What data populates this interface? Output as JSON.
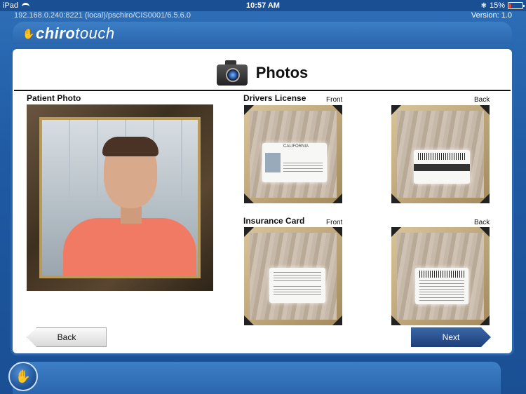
{
  "statusbar": {
    "device": "iPad",
    "time": "10:57 AM",
    "battery": "15%",
    "battery_level": 0.15
  },
  "urlbar": {
    "url": "192.168.0.240:8221 (local)/pschiro/CIS0001/6.5.6.0",
    "version": "Version: 1.0"
  },
  "logo": {
    "text_part1": "chiro",
    "text_part2": "touch"
  },
  "page": {
    "title": "Photos",
    "title_icon": "camera-icon"
  },
  "patient_photo": {
    "label": "Patient Photo"
  },
  "drivers_license": {
    "label": "Drivers License",
    "front_label": "Front",
    "back_label": "Back",
    "front_caption": "CALIFORNIA"
  },
  "insurance_card": {
    "label": "Insurance Card",
    "front_label": "Front",
    "back_label": "Back"
  },
  "buttons": {
    "back": "Back",
    "next": "Next"
  },
  "icons": {
    "wifi": "wifi-icon",
    "bluetooth": "bluetooth-icon",
    "battery": "battery-icon",
    "home": "chirotouch-hand-icon"
  }
}
